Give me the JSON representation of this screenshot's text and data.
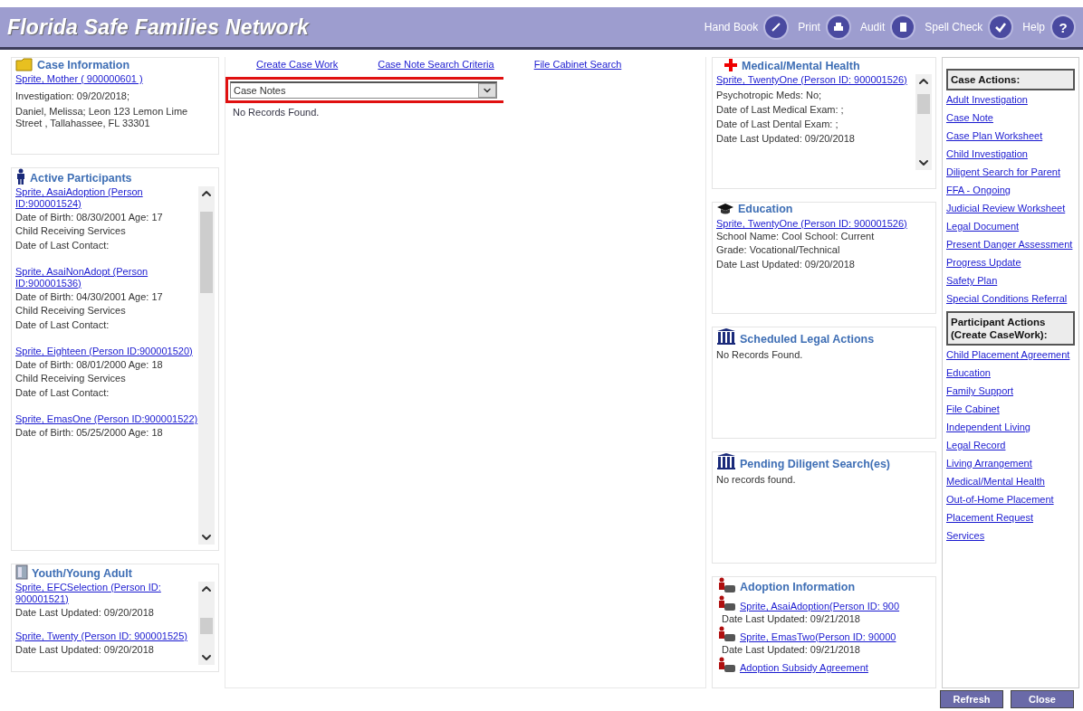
{
  "header": {
    "title": "Florida Safe Families Network",
    "tools": [
      {
        "label": "Hand Book",
        "kind": "pencil"
      },
      {
        "label": "Print",
        "kind": "printer"
      },
      {
        "label": "Audit",
        "kind": "document"
      },
      {
        "label": "Spell Check",
        "kind": "check"
      },
      {
        "label": "Help",
        "kind": "help",
        "glyph": "?"
      }
    ]
  },
  "case_information": {
    "title": "Case Information",
    "link": "Sprite, Mother ( 900000601 )",
    "lines": [
      "Investigation: 09/20/2018;",
      "Daniel, Melissa; Leon 123 Lemon Lime Street , Tallahassee, FL 33301"
    ]
  },
  "active_participants": {
    "title": "Active Participants",
    "people": [
      {
        "link": "Sprite, AsaiAdoption (Person ID:900001524)",
        "lines": [
          "Date of Birth:  08/30/2001   Age: 17",
          "Child Receiving Services",
          "Date of Last Contact:"
        ]
      },
      {
        "link": "Sprite, AsaiNonAdopt (Person ID:900001536)",
        "lines": [
          "Date of Birth:  04/30/2001   Age: 17",
          "Child Receiving Services",
          "Date of Last Contact:"
        ]
      },
      {
        "link": "Sprite, Eighteen (Person ID:900001520)",
        "lines": [
          "Date of Birth:  08/01/2000   Age: 18",
          "Child Receiving Services",
          "Date of Last Contact:"
        ]
      },
      {
        "link": "Sprite, EmasOne (Person ID:900001522)",
        "lines": [
          "Date of Birth:  05/25/2000   Age: 18"
        ]
      }
    ]
  },
  "youth_young_adult": {
    "title": "Youth/Young Adult",
    "people": [
      {
        "link": "Sprite, EFCSelection (Person ID: 900001521)",
        "lines": [
          "Date Last Updated: 09/20/2018"
        ]
      },
      {
        "link": "Sprite, Twenty (Person ID: 900001525)",
        "lines": [
          "Date Last Updated: 09/20/2018"
        ]
      }
    ]
  },
  "center": {
    "links": [
      "Create Case Work",
      "Case Note Search Criteria",
      "File Cabinet Search"
    ],
    "dropdown": {
      "value": "Case Notes",
      "highlighted": true
    },
    "message": "No Records Found."
  },
  "medical_mental_health": {
    "title": "Medical/Mental Health",
    "link": "Sprite, TwentyOne  (Person ID: 900001526)",
    "lines": [
      "Psychotropic Meds:  No;",
      "Date of Last Medical Exam:  ;",
      "Date of Last Dental Exam:  ;",
      "Date Last Updated:  09/20/2018"
    ]
  },
  "education": {
    "title": "Education",
    "link": "Sprite, TwentyOne  (Person ID: 900001526)",
    "inline": " School Name: Cool School: Current",
    "lines": [
      "Grade: Vocational/Technical",
      "Date Last Updated: 09/20/2018"
    ]
  },
  "scheduled_legal_actions": {
    "title": "Scheduled Legal Actions",
    "message": "No Records Found."
  },
  "pending_diligent_searches": {
    "title": "Pending Diligent Search(es)",
    "message": "No records found."
  },
  "adoption_information": {
    "title": "Adoption Information",
    "items": [
      {
        "link": "Sprite, AsaiAdoption(Person ID: 900",
        "date": "Date Last Updated: 09/21/2018"
      },
      {
        "link": "Sprite, EmasTwo(Person ID: 90000",
        "date": "Date Last Updated: 09/21/2018"
      }
    ],
    "agreement": "Adoption Subsidy Agreement"
  },
  "actions": [
    {
      "heading": "Case Actions:",
      "links": [
        "Adult Investigation",
        "Case Note",
        "Case Plan Worksheet",
        "Child Investigation",
        "Diligent Search for Parent",
        "FFA - Ongoing",
        "Judicial Review Worksheet",
        "Legal Document",
        "Present Danger Assessment",
        "Progress Update",
        "Safety Plan",
        "Special Conditions Referral"
      ]
    },
    {
      "heading": "Participant Actions (Create CaseWork):",
      "links": [
        "Child Placement Agreement",
        "Education",
        "Family Support",
        "File Cabinet",
        "Independent Living",
        "Legal Record",
        "Living Arrangement",
        "Medical/Mental Health",
        "Out-of-Home Placement",
        "Placement Request",
        "Services"
      ]
    }
  ],
  "buttons": [
    "Refresh",
    "Close"
  ]
}
